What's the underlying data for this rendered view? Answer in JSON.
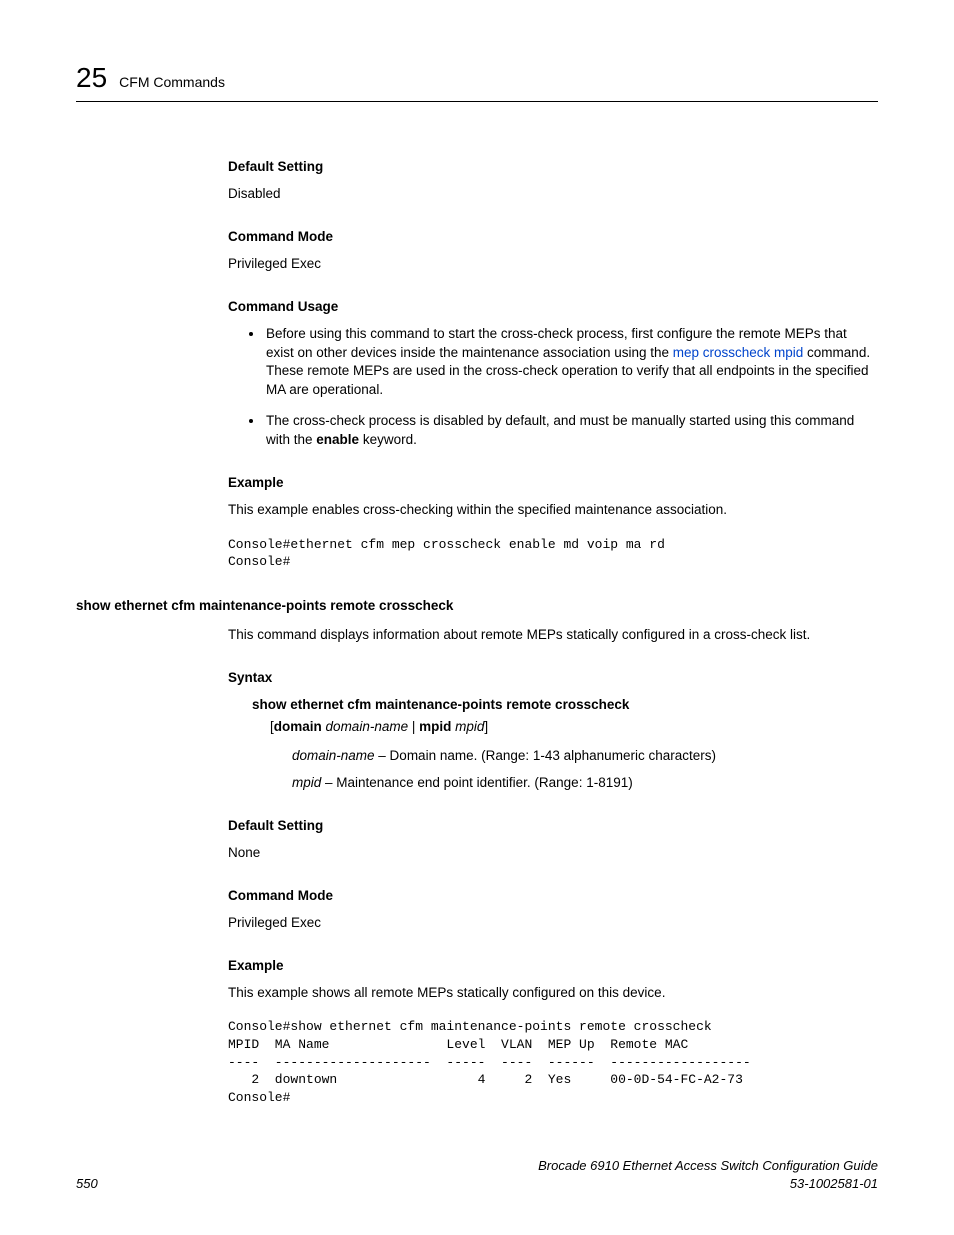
{
  "header": {
    "chapno": "25",
    "chaptitle": "CFM Commands"
  },
  "sections": {
    "defset1_h": "Default Setting",
    "defset1_p": "Disabled",
    "cmdmode1_h": "Command Mode",
    "cmdmode1_p": "Privileged Exec",
    "usage_h": "Command Usage",
    "usage_b1_pre": "Before using this command to start the cross-check process, first configure the remote MEPs that exist on other devices inside the maintenance association using the ",
    "usage_b1_link": "mep crosscheck mpid",
    "usage_b1_post": " command. These remote MEPs are used in the cross-check operation to verify that all endpoints in the specified MA are operational.",
    "usage_b2_pre": "The cross-check process is disabled by default, and must be manually started using this command with the ",
    "usage_b2_bold": "enable",
    "usage_b2_post": " keyword.",
    "example1_h": "Example",
    "example1_p": "This example enables cross-checking within the specified maintenance association.",
    "example1_code": "Console#ethernet cfm mep crosscheck enable md voip ma rd\nConsole#",
    "cmd2_title": "show ethernet cfm maintenance-points remote crosscheck",
    "cmd2_desc": "This command displays information about remote MEPs statically configured in a cross-check list.",
    "syntax_h": "Syntax",
    "syntax_line": "show ethernet cfm maintenance-points remote crosscheck",
    "syntax_args_domain": "domain",
    "syntax_args_domainname": "domain-name",
    "syntax_args_mpid": "mpid",
    "syntax_args_mpidv": "mpid",
    "param1_name": "domain-name",
    "param1_desc": " – Domain name. (Range: 1-43 alphanumeric characters)",
    "param2_name": "mpid",
    "param2_desc": " – Maintenance end point identifier. (Range: 1-8191)",
    "defset2_h": "Default Setting",
    "defset2_p": "None",
    "cmdmode2_h": "Command Mode",
    "cmdmode2_p": "Privileged Exec",
    "example2_h": "Example",
    "example2_p": "This example shows all remote MEPs statically configured on this device.",
    "example2_code": "Console#show ethernet cfm maintenance-points remote crosscheck\nMPID  MA Name               Level  VLAN  MEP Up  Remote MAC\n----  --------------------  -----  ----  ------  ------------------\n   2  downtown                  4     2  Yes     00-0D-54-FC-A2-73\nConsole#"
  },
  "footer": {
    "page": "550",
    "book": "Brocade 6910 Ethernet Access Switch Configuration Guide",
    "docid": "53-1002581-01"
  }
}
